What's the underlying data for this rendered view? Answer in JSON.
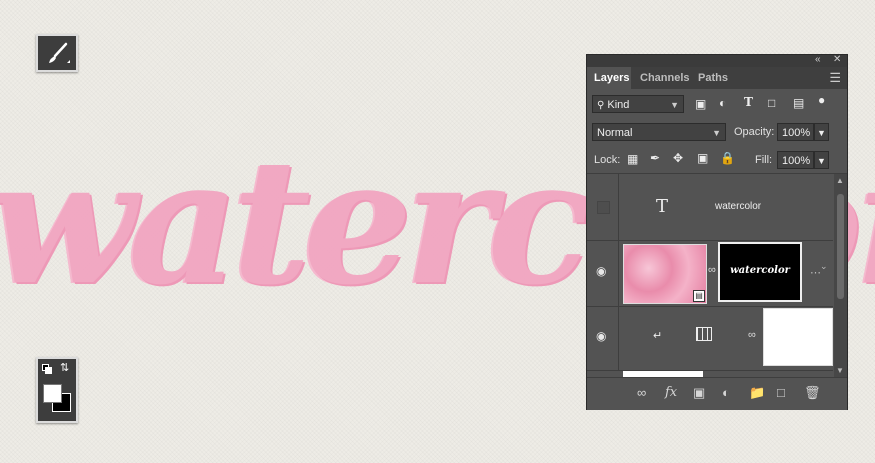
{
  "canvas": {
    "artwork_text": "watercolor"
  },
  "panel": {
    "collapse_icon": "«",
    "close_icon": "✕",
    "tabs": [
      {
        "label": "Layers"
      },
      {
        "label": "Channels"
      },
      {
        "label": "Paths"
      }
    ],
    "filter": {
      "label": "Kind"
    },
    "blend_mode": "Normal",
    "opacity_label": "Opacity:",
    "opacity_value": "100%",
    "lock_label": "Lock:",
    "fill_label": "Fill:",
    "fill_value": "100%",
    "layers": [
      {
        "name": "watercolor",
        "type": "text",
        "visible": false
      },
      {
        "name": "",
        "type": "smart-object-with-mask",
        "mask_text": "watercolor",
        "visible": true
      },
      {
        "name": "",
        "type": "adjustment-clipped",
        "visible": true
      }
    ]
  },
  "colors": {
    "panel_bg": "#535353",
    "pink_text": "#f2a3c0",
    "canvas_bg": "#eeece6"
  }
}
